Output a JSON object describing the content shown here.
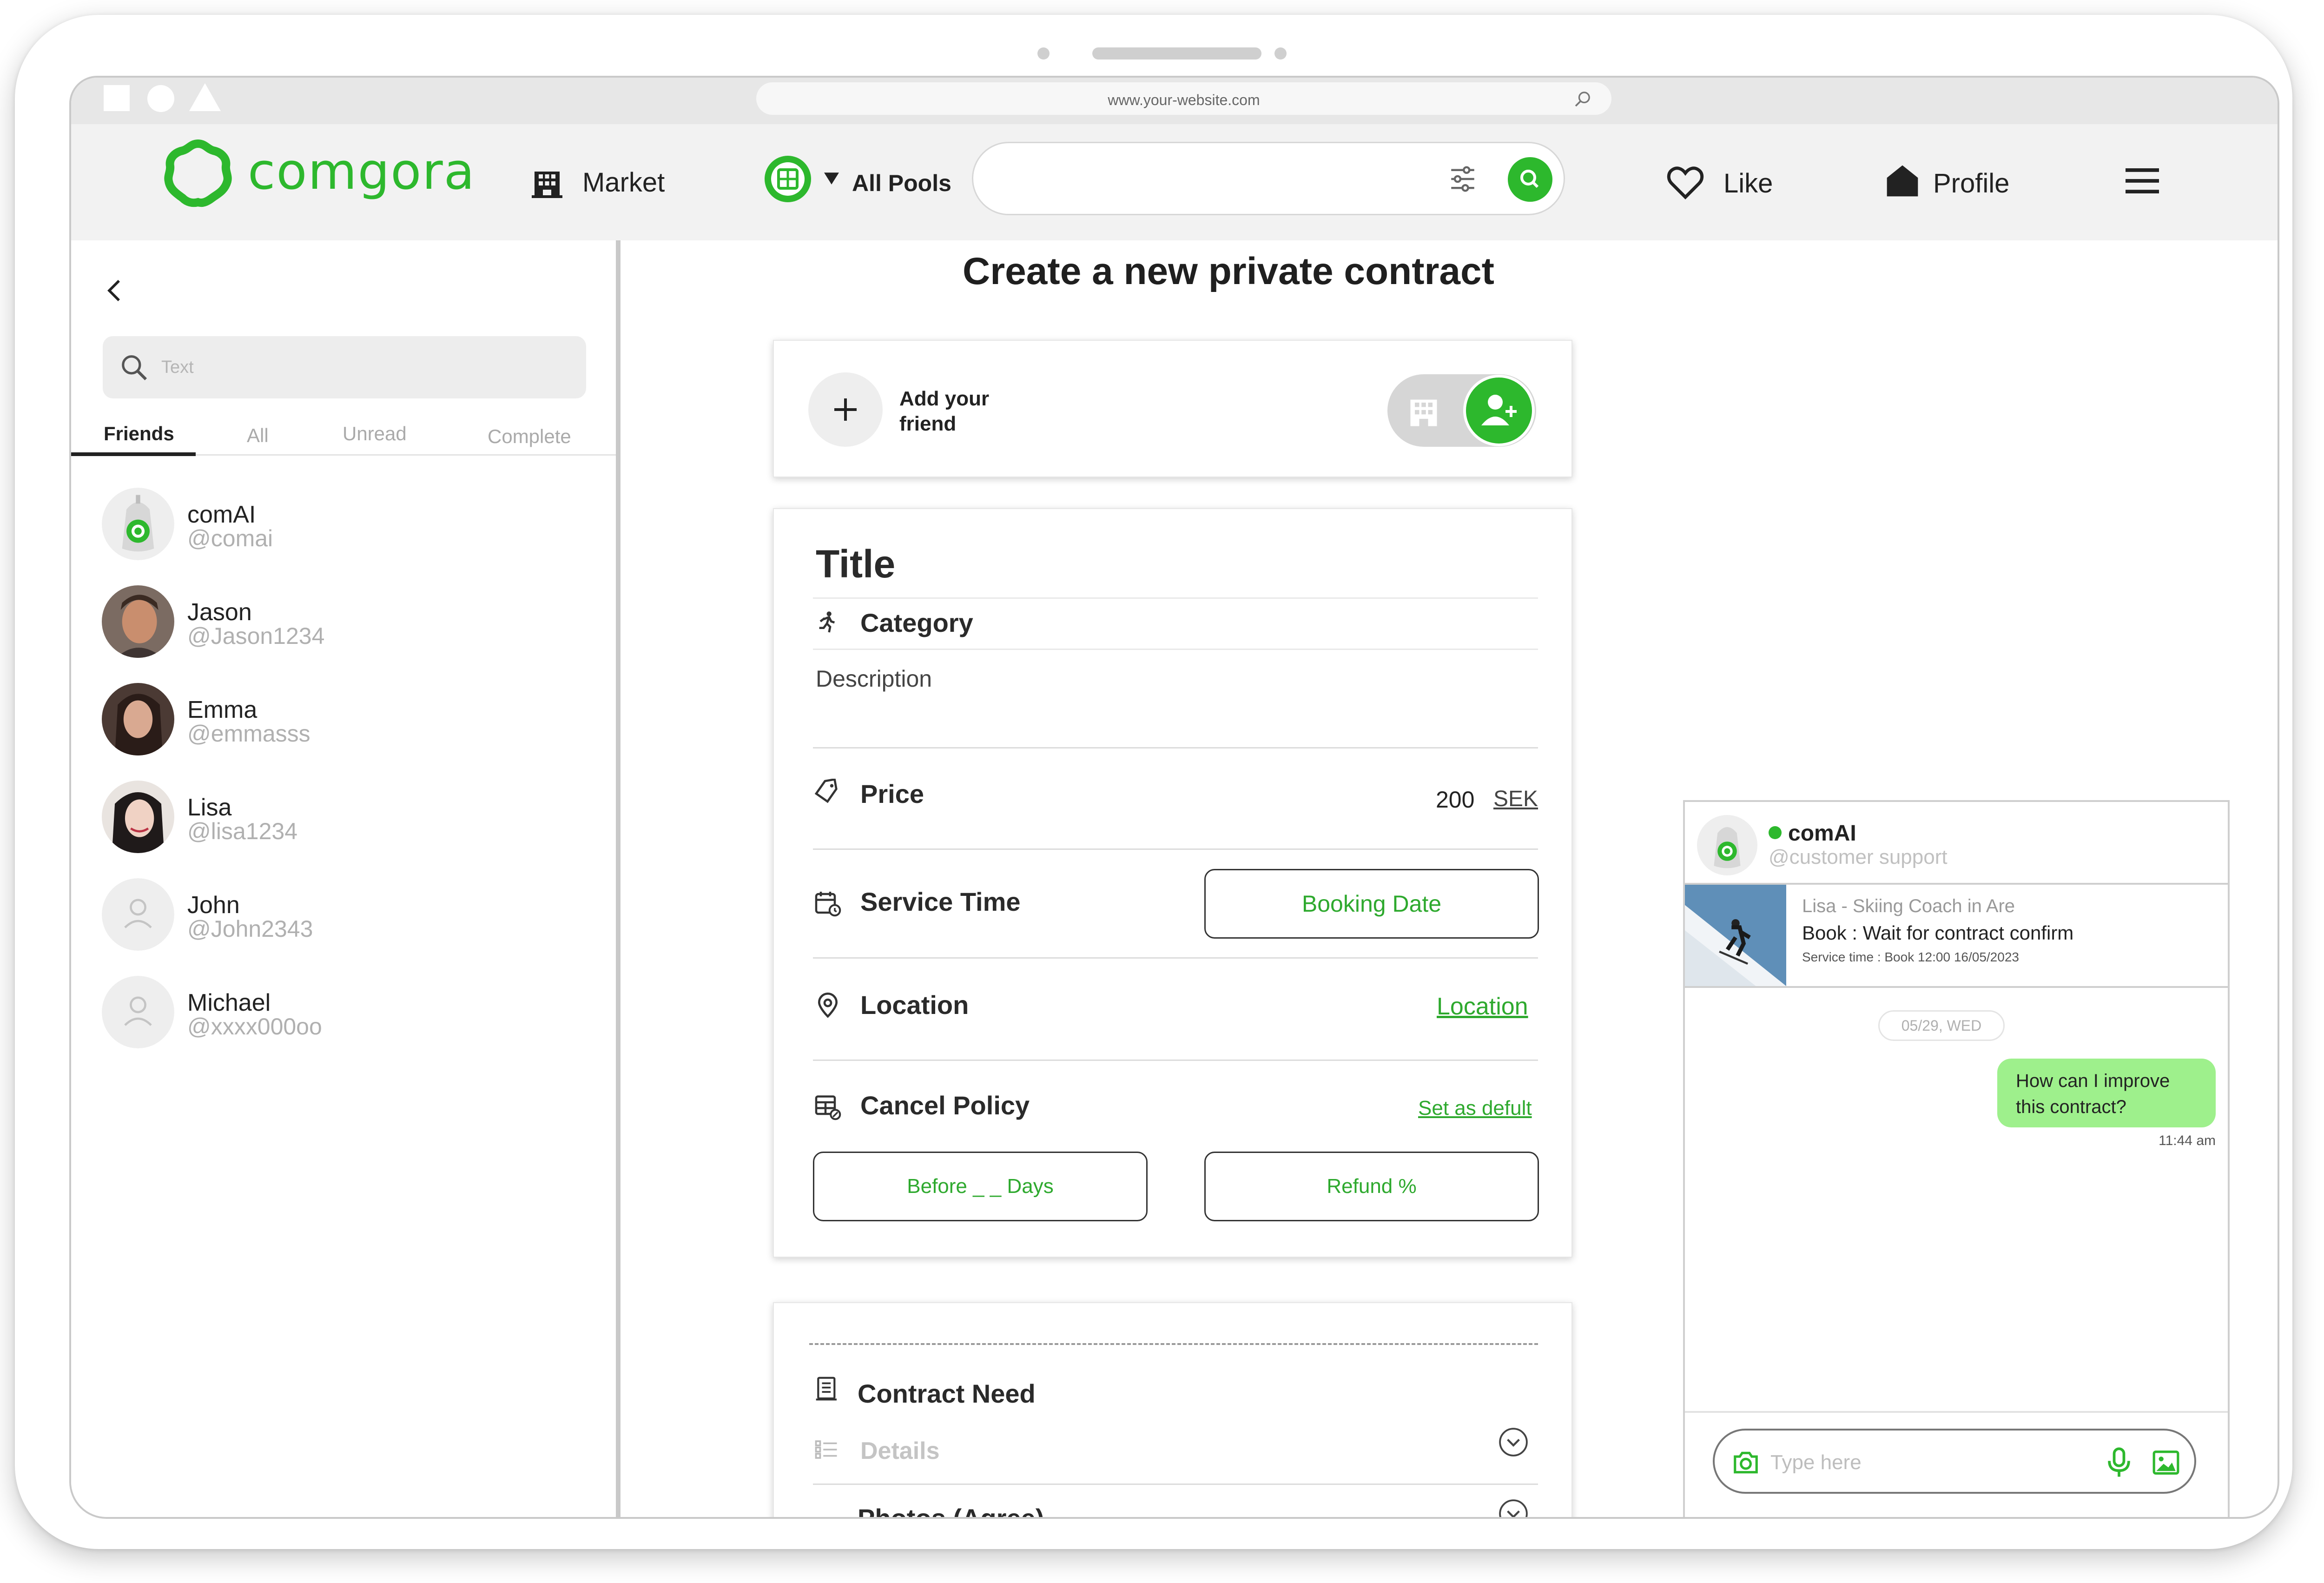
{
  "browser": {
    "url": "www.your-website.com"
  },
  "nav": {
    "logo": "comgora",
    "market": "Market",
    "pools": "All Pools",
    "like": "Like",
    "profile": "Profile"
  },
  "sidebar": {
    "search_placeholder": "Text",
    "tabs": [
      "Friends",
      "All",
      "Unread",
      "Complete"
    ],
    "friends": [
      {
        "name": "comAI",
        "handle": "@comai"
      },
      {
        "name": "Jason",
        "handle": "@Jason1234"
      },
      {
        "name": "Emma",
        "handle": "@emmasss"
      },
      {
        "name": "Lisa",
        "handle": "@lisa1234"
      },
      {
        "name": "John",
        "handle": "@John2343"
      },
      {
        "name": "Michael",
        "handle": "@xxxx000oo"
      }
    ]
  },
  "form": {
    "heading": "Create a new private contract",
    "add_friend": "Add your friend",
    "title": "Title",
    "category": "Category",
    "description": "Description",
    "price_label": "Price",
    "price_value": "200",
    "currency": "SEK",
    "service_time": "Service Time",
    "booking_date": "Booking Date",
    "location_label": "Location",
    "location_link": "Location",
    "cancel_policy": "Cancel Policy",
    "set_default": "Set as defult",
    "before_days": "Before _ _ Days",
    "refund": "Refund %",
    "contract_need": "Contract Need",
    "details": "Details",
    "photos": "Photos (Agree)"
  },
  "chat": {
    "name": "comAI",
    "handle": "@customer support",
    "status_color": "#2db82d",
    "booking": {
      "title": "Lisa - Skiing Coach in Are",
      "status": "Book : Wait for contract confirm",
      "service_time": "Service time : Book 12:00 16/05/2023"
    },
    "date_chip": "05/29, WED",
    "message": "How can I improve this contract?",
    "message_time": "11:44 am",
    "input_placeholder": "Type here"
  },
  "colors": {
    "brand": "#2db82d",
    "bubble": "#9ef08c"
  }
}
